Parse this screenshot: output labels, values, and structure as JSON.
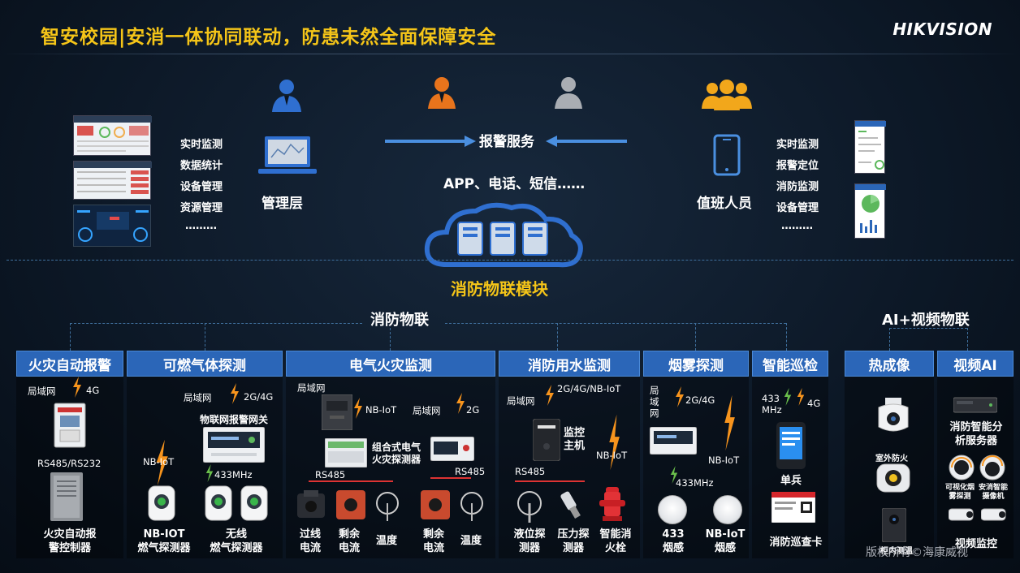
{
  "header": {
    "title": "智安校园|安消一体协同联动，防患未然全面保障安全",
    "brand": "HIKVISION"
  },
  "top": {
    "left_features": [
      "实时监测",
      "数据统计",
      "设备管理",
      "资源管理",
      "………"
    ],
    "management_label": "管理层",
    "alarm_service": "报警服务",
    "channels": "APP、电话、短信……",
    "duty_label": "值班人员",
    "right_features": [
      "实时监测",
      "报警定位",
      "消防监测",
      "设备管理",
      "………"
    ]
  },
  "cloud": {
    "module_label": "消防物联模块"
  },
  "groups": {
    "fire_iot": "消防物联",
    "ai_video": "AI+视频物联"
  },
  "categories": {
    "fire_alarm": "火灾自动报警",
    "gas": "可燃气体探测",
    "electrical": "电气火灾监测",
    "water": "消防用水监测",
    "smoke": "烟雾探测",
    "patrol": "智能巡检",
    "thermal": "热成像",
    "video_ai": "视频AI"
  },
  "fire_alarm": {
    "lan": "局域网",
    "net_4g": "4G",
    "bus": "RS485/RS232",
    "controller": "火灾自动报\n警控制器"
  },
  "gas": {
    "lan": "局域网",
    "net": "2G/4G",
    "gateway": "物联网报警网关",
    "nbiot": "NB-IoT",
    "mhz": "433MHz",
    "det1": "NB-IOT\n燃气探测器",
    "det2": "无线\n燃气探测器"
  },
  "electrical": {
    "lan1": "局域网",
    "nbiot": "NB-IoT",
    "lan2": "局域网",
    "net_2g": "2G",
    "combo": "组合式电气\n火灾探测器",
    "rs485_a": "RS485",
    "rs485_b": "RS485",
    "overcurrent": "过线\n电流",
    "residual1": "剩余\n电流",
    "temp1": "温度",
    "residual2": "剩余\n电流",
    "temp2": "温度"
  },
  "water": {
    "lan": "局域网",
    "net": "2G/4G/NB-IoT",
    "host": "监控\n主机",
    "rs485": "RS485",
    "nbiot": "NB-IoT",
    "level": "液位探\n测器",
    "pressure": "压力探\n测器",
    "hydrant": "智能消\n火栓"
  },
  "smoke": {
    "lan": "局\n域\n网",
    "net": "2G/4G",
    "nbiot": "NB-IoT",
    "mhz": "433MHz",
    "det433": "433\n烟感",
    "detnb": "NB-IoT\n烟感"
  },
  "patrol": {
    "mhz": "433\nMHz",
    "net_4g": "4G",
    "soldier": "单兵",
    "card": "消防巡查卡"
  },
  "thermal": {
    "outdoor": "室外防火",
    "indoor": "柜内测温"
  },
  "video_ai": {
    "server": "消防智能分\n析服务器",
    "cam1": "可视化烟\n雾探测",
    "cam2": "安消智能\n摄像机",
    "monitor": "视频监控"
  },
  "watermark": "版权所有©海康威视",
  "colors": {
    "title": "#f5c518",
    "category_blue": "#2b66b8",
    "bolt": "#f7941d",
    "icon_blue": "#2f6fd0",
    "icon_orange": "#e8741c",
    "icon_gray": "#a9adb3",
    "icon_gold": "#f2a71b"
  }
}
